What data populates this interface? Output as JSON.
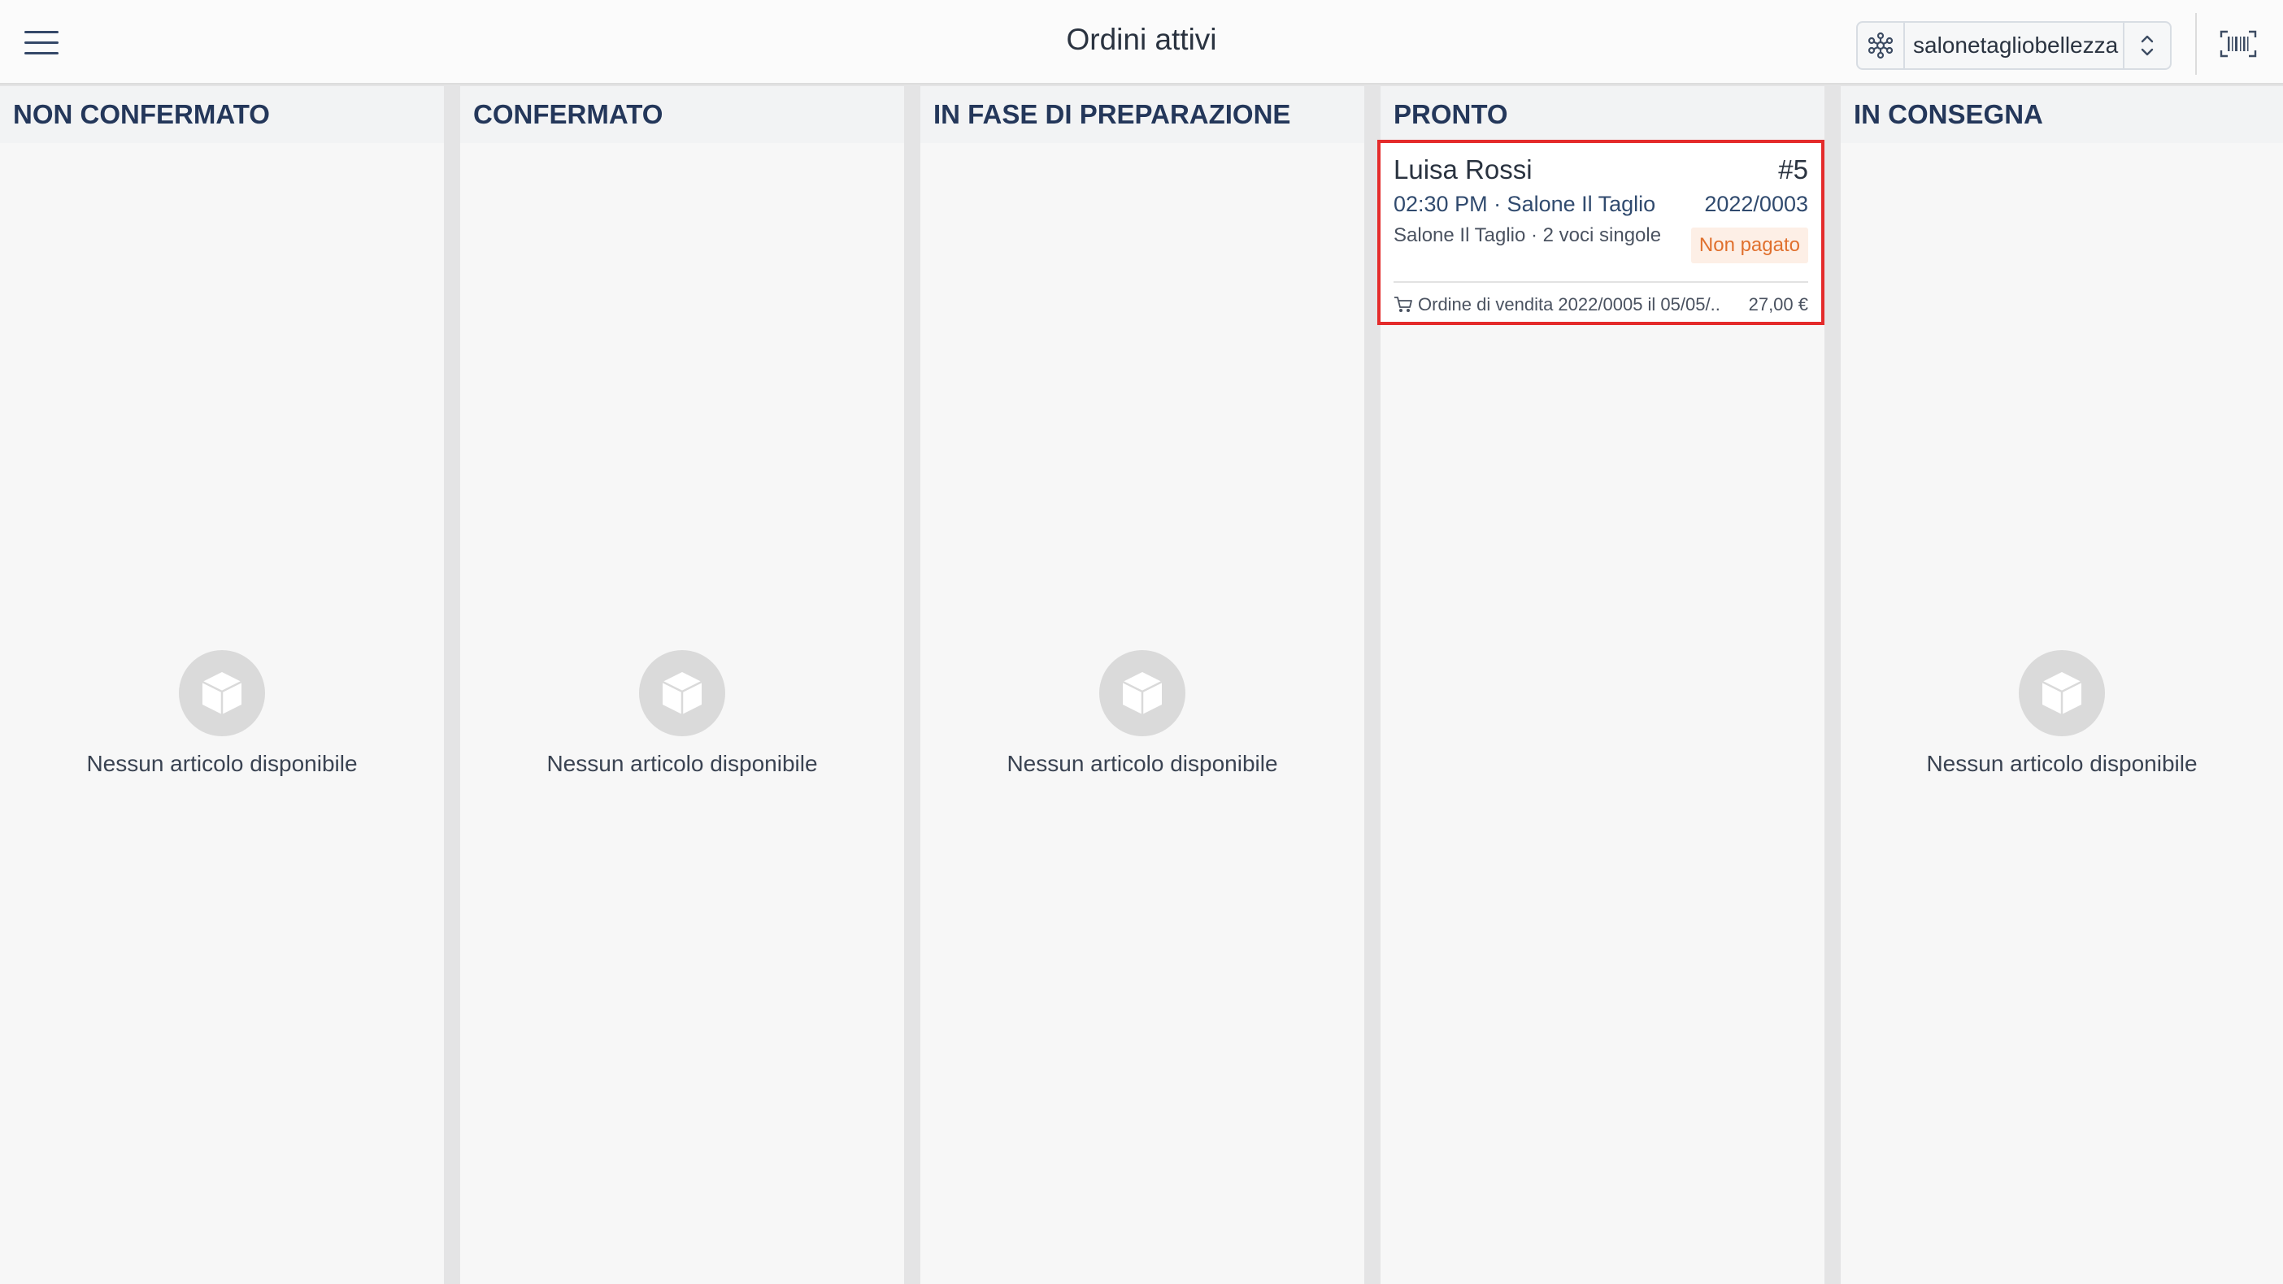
{
  "header": {
    "title": "Ordini attivi",
    "store": "salonetagliobellezza"
  },
  "columns": [
    {
      "title": "NON CONFERMATO",
      "empty_text": "Nessun articolo disponibile"
    },
    {
      "title": "CONFERMATO",
      "empty_text": "Nessun articolo disponibile"
    },
    {
      "title": "IN FASE DI PREPARAZIONE",
      "empty_text": "Nessun articolo disponibile"
    },
    {
      "title": "PRONTO",
      "empty_text": ""
    },
    {
      "title": "IN CONSEGNA",
      "empty_text": "Nessun articolo disponibile"
    }
  ],
  "order": {
    "customer": "Luisa Rossi",
    "number": "#5",
    "time_location": "02:30 PM · Salone Il Taglio",
    "reference": "2022/0003",
    "details": "Salone Il Taglio · 2 voci singole",
    "payment_status": "Non pagato",
    "sales_order": "Ordine di vendita 2022/0005 il 05/05/..",
    "total": "27,00 €"
  },
  "colors": {
    "highlight": "#e42b2b",
    "badge_text": "#e0702e",
    "badge_bg": "#fdefe6",
    "column_title": "#24375a"
  },
  "icons": [
    "menu-icon",
    "store-icon",
    "chevron-updown-icon",
    "barcode-icon",
    "empty-box-icon",
    "cart-icon"
  ]
}
